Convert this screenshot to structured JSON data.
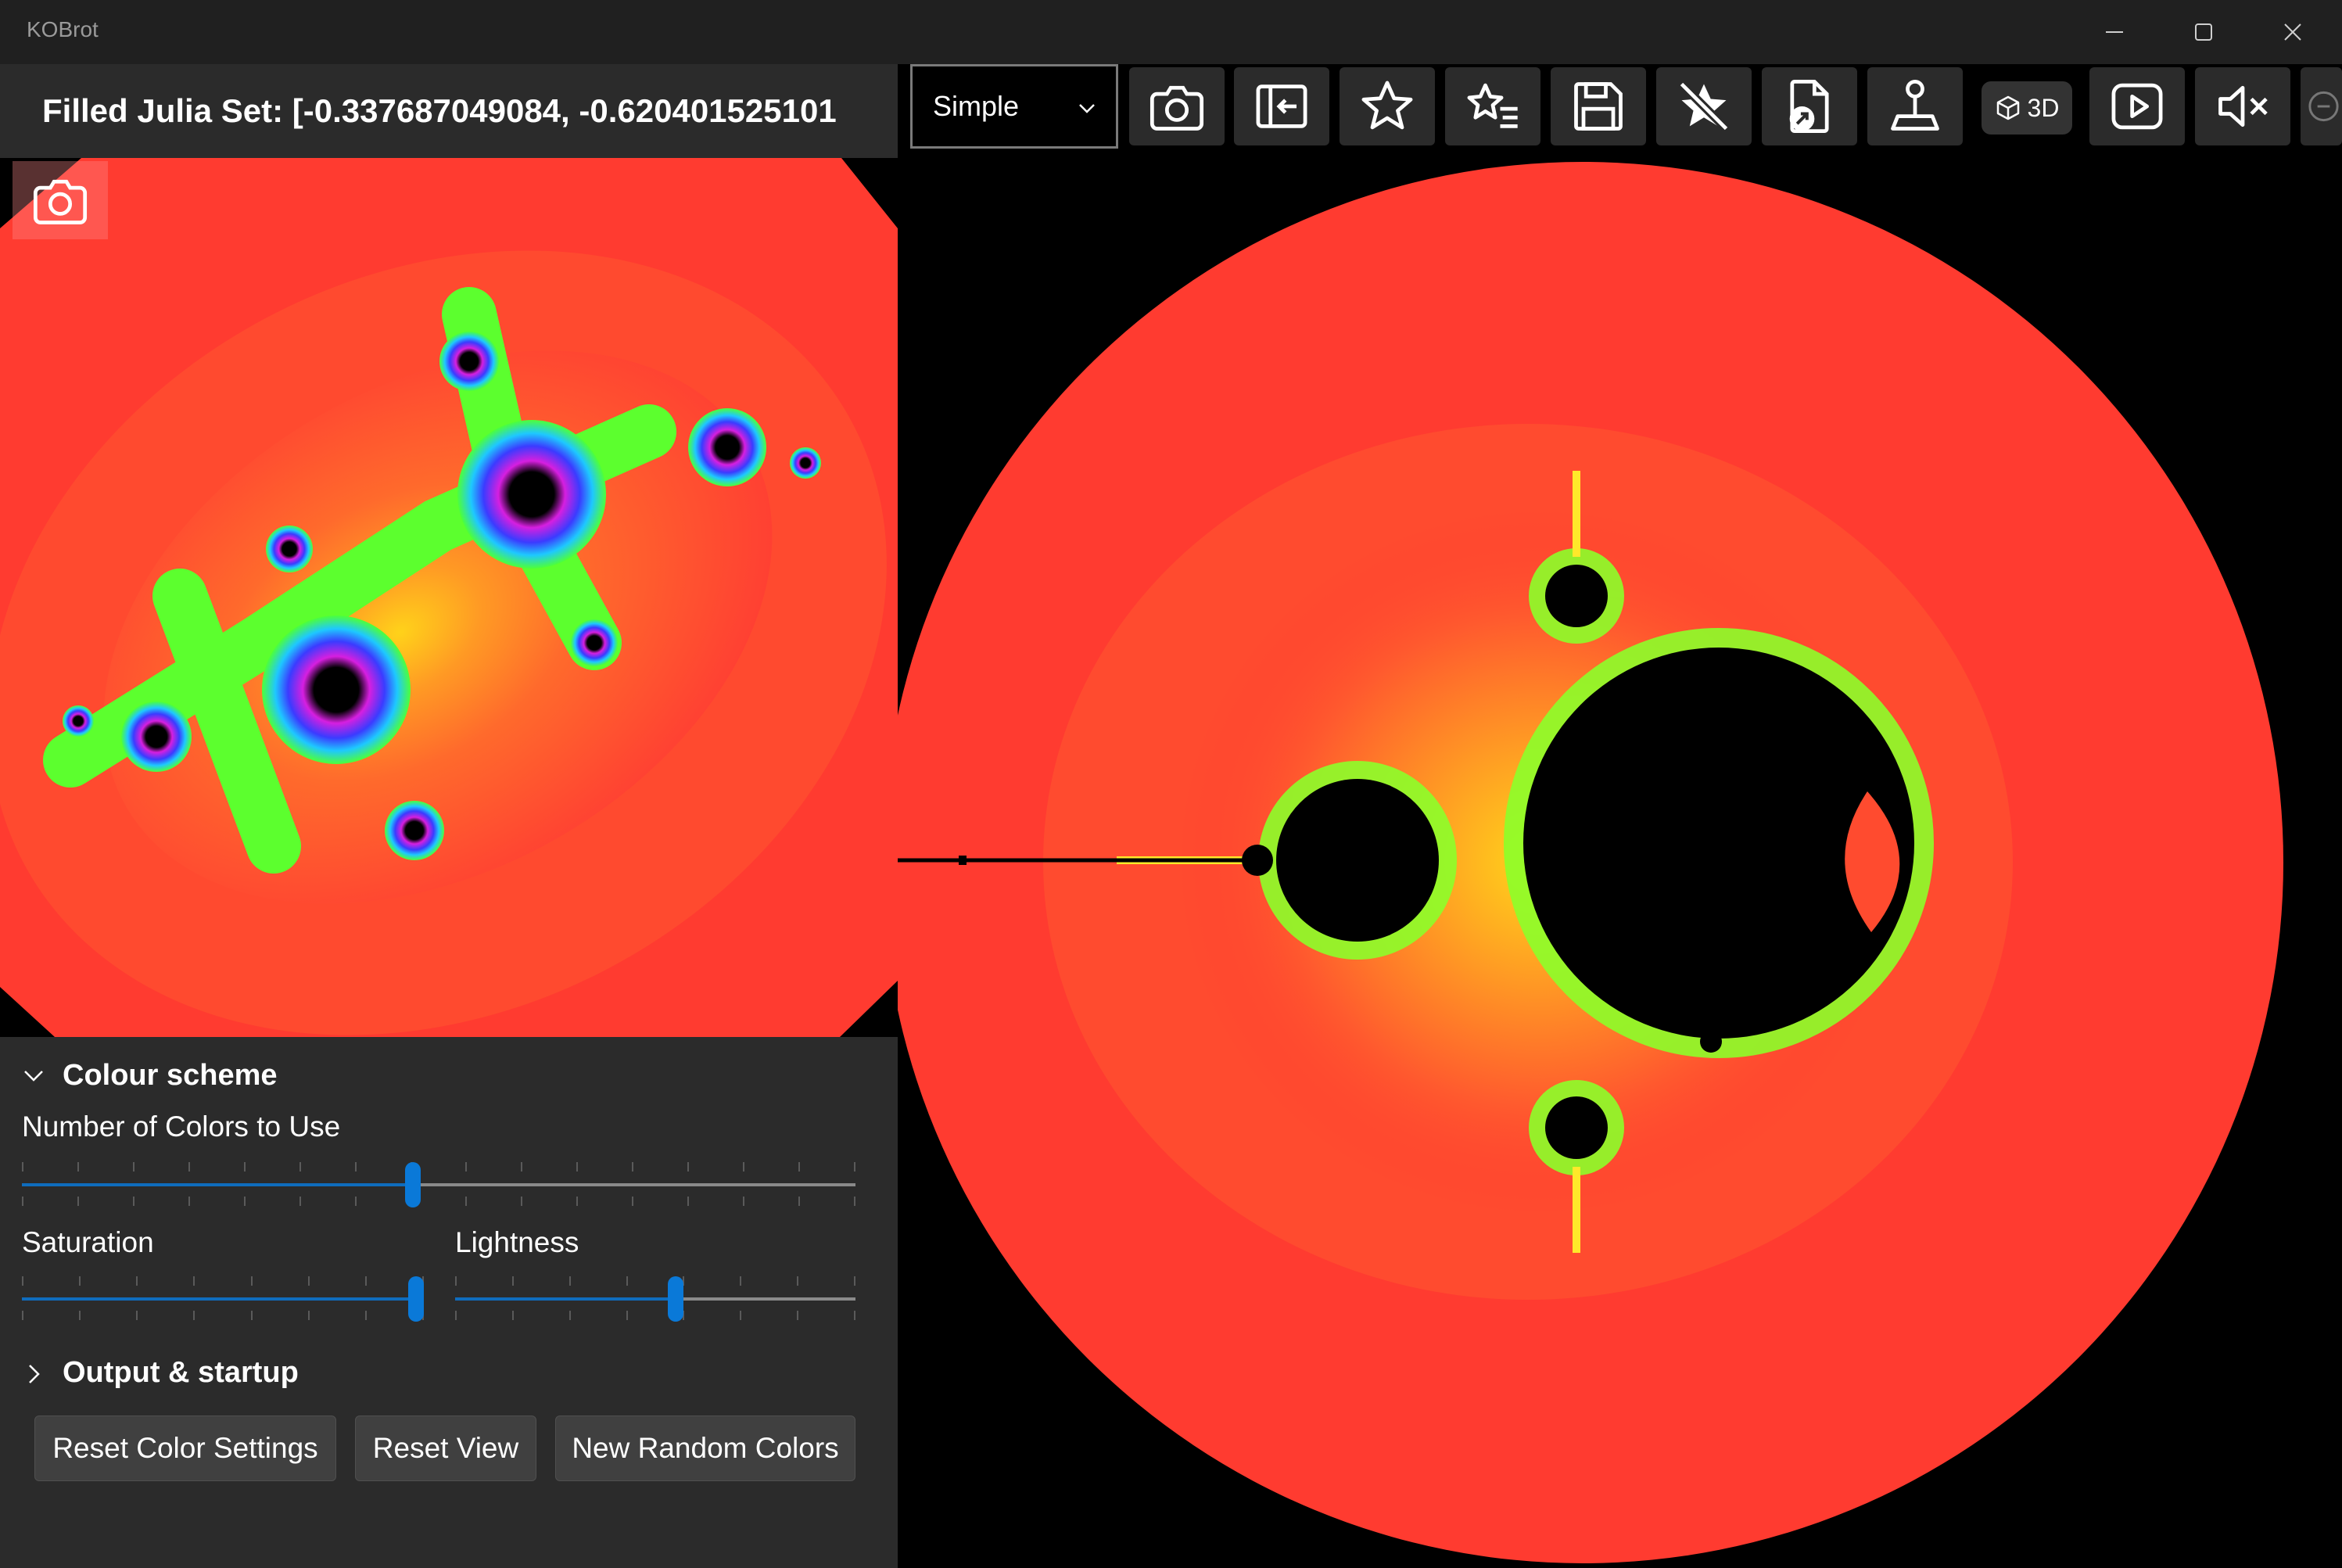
{
  "window": {
    "title": "KOBrot"
  },
  "header": {
    "julia_title": "Filled Julia Set: [-0.337687049084, -0.620401525101"
  },
  "toolbar": {
    "mode_select": {
      "value": "Simple"
    },
    "buttons": [
      {
        "name": "screenshot",
        "icon": "camera-icon"
      },
      {
        "name": "toggle-panel",
        "icon": "panel-left-arrow-icon"
      },
      {
        "name": "add-favourite",
        "icon": "star-icon"
      },
      {
        "name": "favourites-list",
        "icon": "star-list-icon"
      },
      {
        "name": "save",
        "icon": "save-icon"
      },
      {
        "name": "remove-favourite",
        "icon": "star-off-icon"
      },
      {
        "name": "export",
        "icon": "file-export-icon"
      },
      {
        "name": "navigate",
        "icon": "joystick-icon"
      },
      {
        "name": "view-3d",
        "icon": "cube-icon",
        "label": "3D"
      },
      {
        "name": "play",
        "icon": "play-icon"
      },
      {
        "name": "mute",
        "icon": "speaker-mute-icon"
      }
    ]
  },
  "settings": {
    "colour_scheme": {
      "header": "Colour scheme",
      "expanded": true,
      "num_colors": {
        "label": "Number of Colors to Use",
        "position": 0.47
      },
      "saturation": {
        "label": "Saturation",
        "position": 1.0
      },
      "lightness": {
        "label": "Lightness",
        "position": 0.55
      }
    },
    "output_startup": {
      "header": "Output & startup",
      "expanded": false
    },
    "buttons": {
      "reset_color": "Reset Color Settings",
      "reset_view": "Reset View",
      "new_random": "New Random Colors"
    }
  },
  "colors": {
    "fractal_outer": "#ff3b30",
    "accent": "#0f6cbd",
    "panel_bg": "#2b2b2b"
  }
}
